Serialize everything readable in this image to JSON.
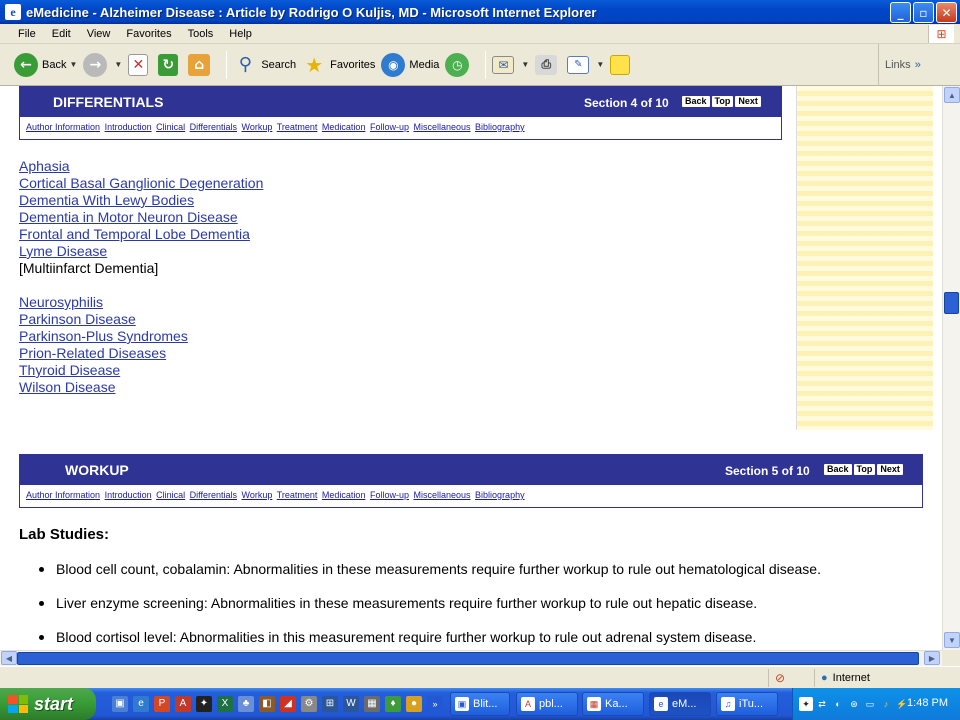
{
  "window": {
    "title": "eMedicine - Alzheimer Disease : Article by Rodrigo O Kuljis, MD - Microsoft Internet Explorer",
    "min": "_",
    "max": "▫",
    "close": "✕"
  },
  "menu": [
    "File",
    "Edit",
    "View",
    "Favorites",
    "Tools",
    "Help"
  ],
  "toolbar": {
    "back": "Back",
    "search": "Search",
    "favorites": "Favorites",
    "media": "Media",
    "links": "Links"
  },
  "differentials": {
    "title": "DIFFERENTIALS",
    "section": "Section 4 of 10",
    "nav": [
      "Back",
      "Top",
      "Next"
    ],
    "links": [
      "Author Information",
      "Introduction",
      "Clinical",
      "Differentials",
      "Workup",
      "Treatment",
      "Medication",
      "Follow-up",
      "Miscellaneous",
      "Bibliography"
    ],
    "items_a": [
      "Aphasia",
      "Cortical Basal Ganglionic Degeneration",
      "Dementia With Lewy Bodies",
      "Dementia in Motor Neuron Disease",
      "Frontal and Temporal Lobe Dementia",
      "Lyme Disease"
    ],
    "plain_item": "[Multiinfarct Dementia]",
    "items_b": [
      "Neurosyphilis",
      "Parkinson Disease",
      "Parkinson-Plus Syndromes",
      "Prion-Related Diseases",
      "Thyroid Disease",
      "Wilson Disease"
    ]
  },
  "workup": {
    "title": "WORKUP",
    "section": "Section 5 of 10",
    "nav": [
      "Back",
      "Top",
      "Next"
    ],
    "links": [
      "Author Information",
      "Introduction",
      "Clinical",
      "Differentials",
      "Workup",
      "Treatment",
      "Medication",
      "Follow-up",
      "Miscellaneous",
      "Bibliography"
    ],
    "lab_heading": "Lab Studies:",
    "bullets": [
      "Blood cell count, cobalamin: Abnormalities in these measurements require further workup to rule out hematological disease.",
      "Liver enzyme screening: Abnormalities in these measurements require further workup to rule out hepatic disease.",
      "Blood cortisol level: Abnormalities in this measurement require further workup to rule out adrenal system disease."
    ]
  },
  "status": {
    "zone": "Internet"
  },
  "taskbar": {
    "start": "start",
    "tasks": [
      "Blit...",
      "pbl...",
      "Ka...",
      "eM...",
      "iTu..."
    ],
    "clock": "1:48 PM"
  }
}
